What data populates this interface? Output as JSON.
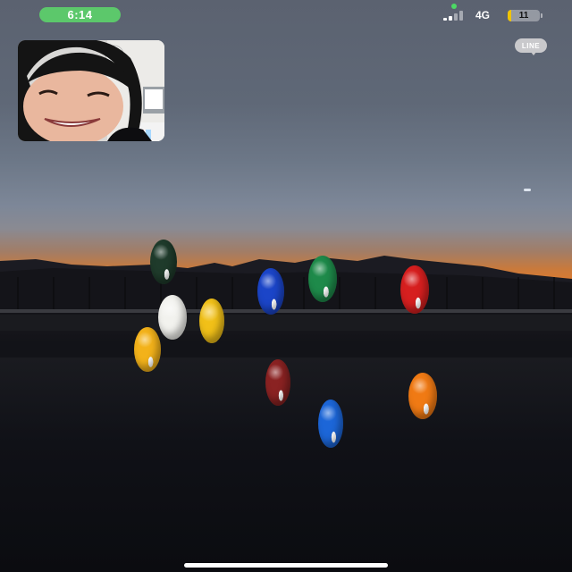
{
  "status_bar": {
    "time": "6:14",
    "network": "4G",
    "battery_level": "11",
    "battery_percent": 11
  },
  "app_badge": {
    "label": "LINE"
  },
  "colors": {
    "time_pill": "#5cc86b",
    "battery_low": "#f0c400",
    "badge": "#c9c9cc"
  },
  "balls": [
    {
      "color": "#1f3b2b",
      "kind": "striped"
    },
    {
      "color": "#1e8a4a",
      "kind": "striped"
    },
    {
      "color": "#1b45c8",
      "kind": "striped"
    },
    {
      "color": "#d61f1f",
      "kind": "striped"
    },
    {
      "color": "#f2f2ee",
      "kind": "cue"
    },
    {
      "color": "#f1c018",
      "kind": "solid"
    },
    {
      "color": "#f3b21a",
      "kind": "striped"
    },
    {
      "color": "#8a2222",
      "kind": "striped"
    },
    {
      "color": "#f07a14",
      "kind": "striped"
    },
    {
      "color": "#1c66d8",
      "kind": "striped"
    }
  ]
}
